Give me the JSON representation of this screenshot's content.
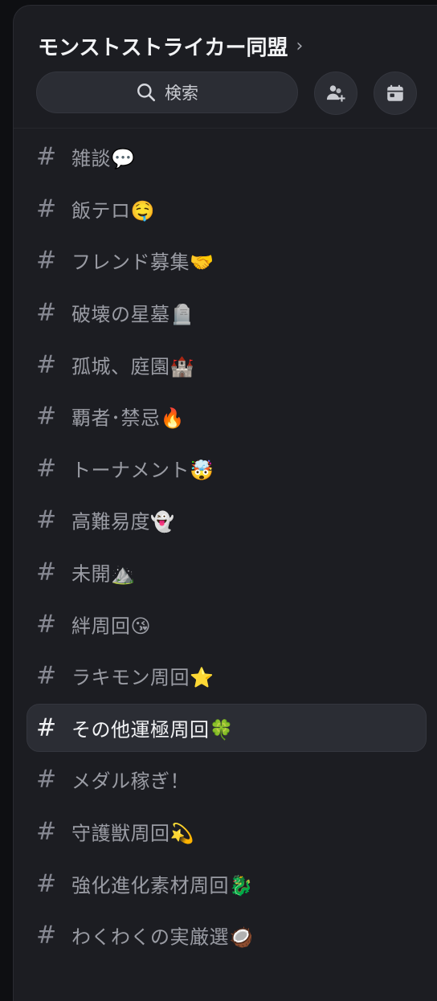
{
  "server": {
    "title": "モンストストライカー同盟",
    "chevron_icon": "chevron-right-icon"
  },
  "search": {
    "label": "検索",
    "icon": "search-icon"
  },
  "actions": {
    "invite_icon": "add-member-icon",
    "events_icon": "calendar-icon"
  },
  "channels": [
    {
      "hash": "#",
      "name": "雑談💬"
    },
    {
      "hash": "#",
      "name": "飯テロ🤤"
    },
    {
      "hash": "#",
      "name": "フレンド募集🤝"
    },
    {
      "hash": "#",
      "name": "破壊の星墓🪦"
    },
    {
      "hash": "#",
      "name": "孤城、庭園🏰"
    },
    {
      "hash": "#",
      "name": "覇者･禁忌🔥"
    },
    {
      "hash": "#",
      "name": "トーナメント🤯"
    },
    {
      "hash": "#",
      "name": "高難易度👻"
    },
    {
      "hash": "#",
      "name": "未開⛰️"
    },
    {
      "hash": "#",
      "name": "絆周回😘"
    },
    {
      "hash": "#",
      "name": "ラキモン周回⭐"
    },
    {
      "hash": "#",
      "name": "その他運極周回🍀",
      "selected": true
    },
    {
      "hash": "#",
      "name": "メダル稼ぎ！"
    },
    {
      "hash": "#",
      "name": "守護獣周回💫"
    },
    {
      "hash": "#",
      "name": "強化進化素材周回🐉"
    },
    {
      "hash": "#",
      "name": "わくわくの実厳選🥥"
    }
  ],
  "colors": {
    "background": "#1c1d22",
    "selected_row": "#2b2d34",
    "text_muted": "#9a9ca4",
    "text_active": "#f2f3f5"
  }
}
